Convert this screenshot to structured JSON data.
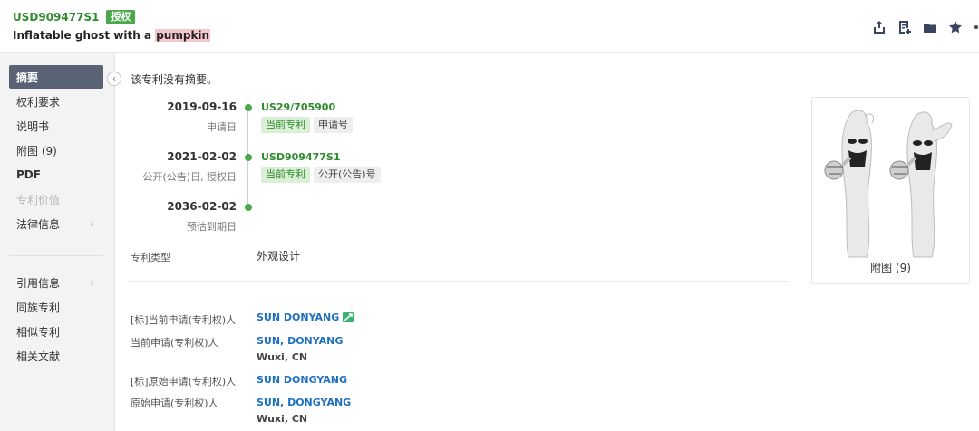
{
  "header": {
    "pub_number": "USD909477S1",
    "status_badge": "授权",
    "title_prefix": "Inflatable ghost with a ",
    "title_highlight": "pumpkin"
  },
  "toolbar": {
    "icons": [
      "share-icon",
      "add-note-icon",
      "folder-icon",
      "star-icon"
    ]
  },
  "sidebar": {
    "items": [
      {
        "label": "摘要"
      },
      {
        "label": "权利要求"
      },
      {
        "label": "说明书"
      },
      {
        "label": "附图 (9)"
      },
      {
        "label": "PDF"
      },
      {
        "label": "专利价值"
      },
      {
        "label": "法律信息"
      },
      {
        "label": "引用信息"
      },
      {
        "label": "同族专利"
      },
      {
        "label": "相似专利"
      },
      {
        "label": "相关文献"
      }
    ]
  },
  "main": {
    "abstract_text": "该专利没有摘要。",
    "timeline": [
      {
        "date": "2019-09-16",
        "sub": "申请日",
        "number": "US29/705900",
        "tags": [
          "当前专利",
          "申请号"
        ]
      },
      {
        "date": "2021-02-02",
        "sub": "公开(公告)日, 授权日",
        "number": "USD909477S1",
        "tags": [
          "当前专利",
          "公开(公告)号"
        ]
      },
      {
        "date": "2036-02-02",
        "sub": "预估到期日"
      }
    ],
    "patent_type_label": "专利类型",
    "patent_type_value": "外观设计",
    "applicants": [
      {
        "label": "[标]当前申请(专利权)人",
        "name": "SUN DONYANG"
      },
      {
        "label": "当前申请(专利权)人",
        "name": "SUN, DONYANG",
        "location": "Wuxi, CN"
      },
      {
        "label": "[标]原始申请(专利权)人",
        "name": "SUN DONGYANG"
      },
      {
        "label": "原始申请(专利权)人",
        "name": "SUN, DONGYANG",
        "location": "Wuxi, CN"
      }
    ],
    "figure_caption": "附图 (9)"
  },
  "colors": {
    "accent_green": "#4aa84a",
    "link_blue": "#1f6fc1",
    "active_nav": "#5a6375",
    "highlight": "#f4c7cc"
  }
}
